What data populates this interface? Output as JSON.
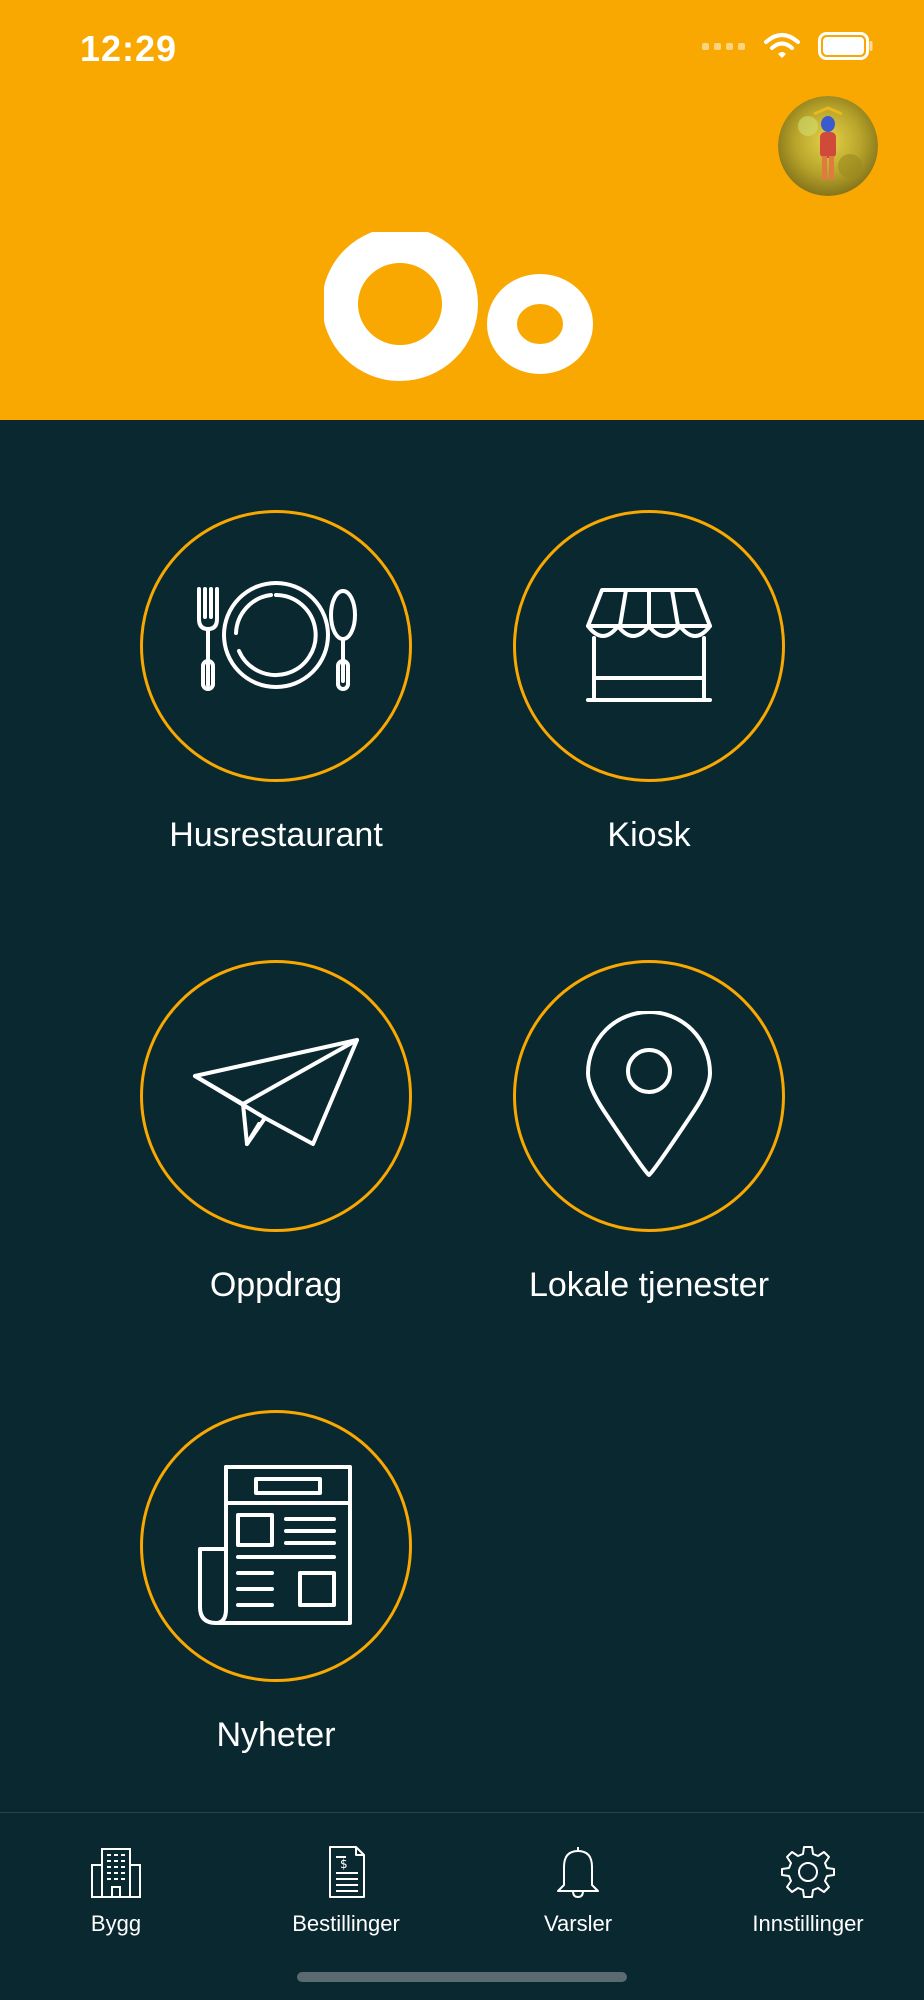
{
  "status_bar": {
    "time": "12:29"
  },
  "colors": {
    "accent": "#f8a800",
    "background": "#0a2830",
    "text": "#ffffff"
  },
  "header": {
    "logo_text": "Oo"
  },
  "menu": {
    "items": [
      {
        "label": "Husrestaurant",
        "icon": "plate-cutlery-icon"
      },
      {
        "label": "Kiosk",
        "icon": "storefront-icon"
      },
      {
        "label": "Oppdrag",
        "icon": "paper-plane-icon"
      },
      {
        "label": "Lokale tjenester",
        "icon": "map-pin-icon"
      },
      {
        "label": "Nyheter",
        "icon": "newspaper-icon"
      }
    ]
  },
  "tabbar": {
    "items": [
      {
        "label": "Bygg",
        "icon": "building-icon"
      },
      {
        "label": "Bestillinger",
        "icon": "invoice-icon"
      },
      {
        "label": "Varsler",
        "icon": "bell-icon"
      },
      {
        "label": "Innstillinger",
        "icon": "gear-icon"
      }
    ]
  }
}
